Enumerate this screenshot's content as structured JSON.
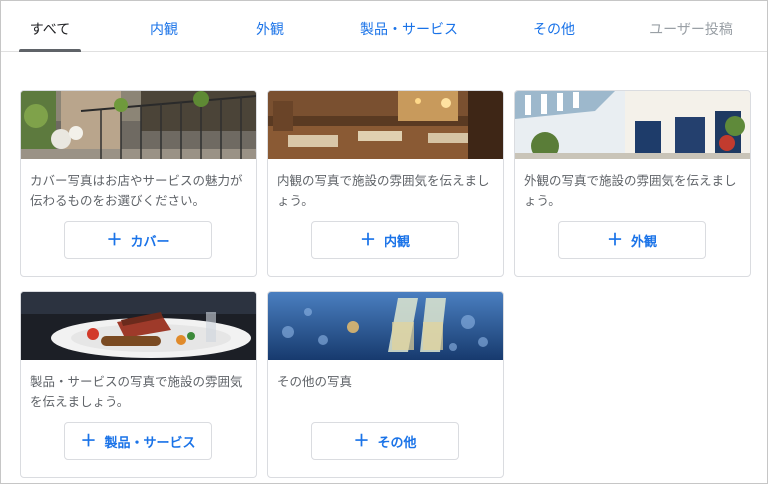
{
  "tabs": [
    {
      "label": "すべて",
      "state": "active"
    },
    {
      "label": "内観",
      "state": "link"
    },
    {
      "label": "外観",
      "state": "link"
    },
    {
      "label": "製品・サービス",
      "state": "link"
    },
    {
      "label": "その他",
      "state": "link"
    },
    {
      "label": "ユーザー投稿",
      "state": "disabled"
    }
  ],
  "cards": [
    {
      "photo": "terrace-photo",
      "description": "カバー写真はお店やサービスの魅力が伝わるものをお選びください。",
      "button_label": "カバー"
    },
    {
      "photo": "interior-photo",
      "description": "内観の写真で施設の雰囲気を伝えましょう。",
      "button_label": "内観"
    },
    {
      "photo": "exterior-photo",
      "description": "外観の写真で施設の雰囲気を伝えましょう。",
      "button_label": "外観"
    },
    {
      "photo": "steak-dish-photo",
      "description": "製品・サービスの写真で施設の雰囲気を伝えましょう。",
      "button_label": "製品・サービス"
    },
    {
      "photo": "champagne-photo",
      "description": "その他の写真",
      "button_label": "その他"
    }
  ],
  "colors": {
    "accent": "#1a73e8",
    "border": "#dadce0",
    "text": "#5f6368"
  },
  "icons": {
    "add": "plus-icon"
  },
  "add_glyph": "＋"
}
